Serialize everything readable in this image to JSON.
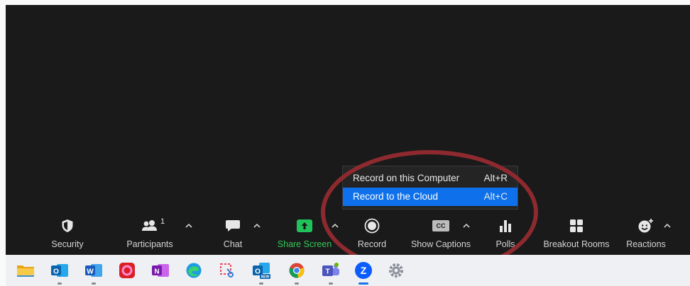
{
  "toolbar": {
    "security": {
      "label": "Security",
      "icon": "shield-icon"
    },
    "participants": {
      "label": "Participants",
      "count": "1",
      "icon": "participants-icon"
    },
    "chat": {
      "label": "Chat",
      "icon": "chat-bubble-icon"
    },
    "share_screen": {
      "label": "Share Screen",
      "icon": "share-screen-icon",
      "color": "#35c75a"
    },
    "record": {
      "label": "Record",
      "icon": "record-icon"
    },
    "show_captions": {
      "label": "Show Captions",
      "icon": "cc-icon",
      "cc_text": "CC"
    },
    "polls": {
      "label": "Polls",
      "icon": "polls-icon"
    },
    "breakout_rooms": {
      "label": "Breakout Rooms",
      "icon": "breakout-rooms-icon"
    },
    "reactions": {
      "label": "Reactions",
      "icon": "reactions-icon"
    }
  },
  "record_menu": {
    "items": [
      {
        "label": "Record on this Computer",
        "shortcut": "Alt+R",
        "selected": false
      },
      {
        "label": "Record to the Cloud",
        "shortcut": "Alt+C",
        "selected": true
      }
    ],
    "highlight_color": "#0e71eb"
  },
  "annotation": {
    "shape": "ellipse",
    "color": "#8e2a2f"
  },
  "taskbar": {
    "apps": [
      {
        "name": "file-explorer-icon"
      },
      {
        "name": "outlook-icon",
        "text": "O"
      },
      {
        "name": "word-icon",
        "text": "W"
      },
      {
        "name": "creative-cloud-icon"
      },
      {
        "name": "onenote-icon",
        "text": "N"
      },
      {
        "name": "edge-icon"
      },
      {
        "name": "snipping-tool-icon"
      },
      {
        "name": "new-outlook-icon",
        "text": "O",
        "badge": "NEW"
      },
      {
        "name": "chrome-icon"
      },
      {
        "name": "teams-icon",
        "text": "T"
      },
      {
        "name": "zoom-icon",
        "text": "Z",
        "active": true
      },
      {
        "name": "settings-icon"
      }
    ]
  }
}
